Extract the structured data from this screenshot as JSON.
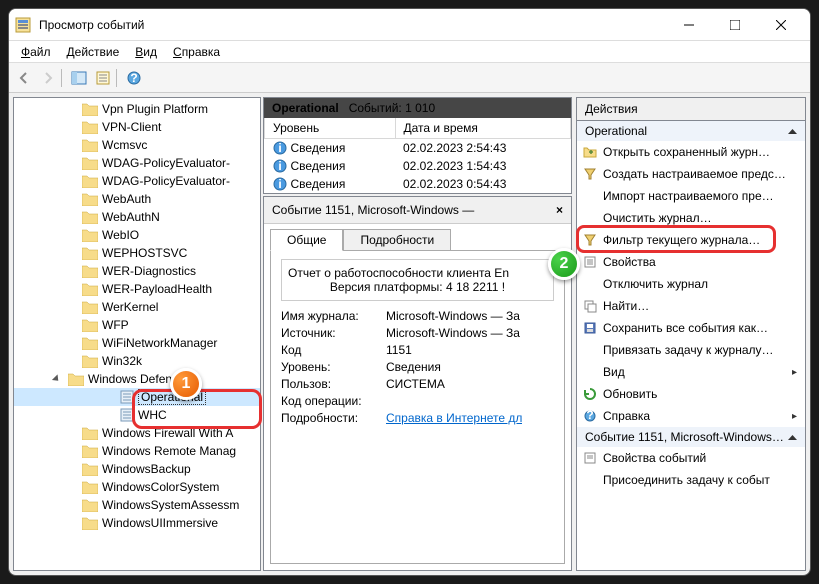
{
  "window": {
    "title": "Просмотр событий"
  },
  "menu": {
    "file": "Файл",
    "action": "Действие",
    "view": "Вид",
    "help": "Справка"
  },
  "tree": {
    "items": [
      "Vpn Plugin Platform",
      "VPN-Client",
      "Wcmsvc",
      "WDAG-PolicyEvaluator-",
      "WDAG-PolicyEvaluator-",
      "WebAuth",
      "WebAuthN",
      "WebIO",
      "WEPHOSTSVC",
      "WER-Diagnostics",
      "WER-PayloadHealth",
      "WerKernel",
      "WFP",
      "WiFiNetworkManager",
      "Win32k"
    ],
    "expanded": "Windows Defend",
    "logs": [
      "Operational",
      "WHC"
    ],
    "more": [
      "Windows Firewall With A",
      "Windows Remote Manag",
      "WindowsBackup",
      "WindowsColorSystem",
      "WindowsSystemAssessm",
      "WindowsUIImmersive"
    ]
  },
  "events": {
    "header": {
      "name": "Operational",
      "count_label": "Событий: 1 010"
    },
    "cols": {
      "level": "Уровень",
      "datetime": "Дата и время"
    },
    "rows": [
      {
        "level": "Сведения",
        "dt": "02.02.2023 2:54:43"
      },
      {
        "level": "Сведения",
        "dt": "02.02.2023 1:54:43"
      },
      {
        "level": "Сведения",
        "dt": "02.02.2023 0:54:43"
      }
    ]
  },
  "detail": {
    "title": "Событие 1151, Microsoft-Windows —",
    "tabs": {
      "general": "Общие",
      "details": "Подробности"
    },
    "report1": "Отчет о работоспособности клиента En",
    "report2": "Версия платформы: 4 18 2211 !",
    "kv": {
      "logname": {
        "k": "Имя журнала:",
        "v": "Microsoft-Windows — За"
      },
      "source": {
        "k": "Источник:",
        "v": "Microsoft-Windows — За"
      },
      "code": {
        "k": "Код",
        "v": "1151"
      },
      "level": {
        "k": "Уровень:",
        "v": "Сведения"
      },
      "user": {
        "k": "Пользов:",
        "v": "СИСТЕМА"
      },
      "opcode": {
        "k": "Код операции:",
        "v": ""
      },
      "more": {
        "k": "Подробности:",
        "v": "Справка в Интернете дл"
      }
    }
  },
  "actions": {
    "title": "Действия",
    "section1": "Operational",
    "items1": [
      "Открыть сохраненный журн…",
      "Создать настраиваемое предс…",
      "Импорт настраиваемого пре…",
      "Очистить журнал…",
      "Фильтр текущего журнала…",
      "Свойства",
      "Отключить журнал",
      "Найти…",
      "Сохранить все события как…",
      "Привязать задачу к журналу…",
      "Вид",
      "Обновить",
      "Справка"
    ],
    "section2": "Событие 1151, Microsoft-Windows…",
    "items2": [
      "Свойства событий",
      "Присоединить задачу к событ"
    ]
  }
}
